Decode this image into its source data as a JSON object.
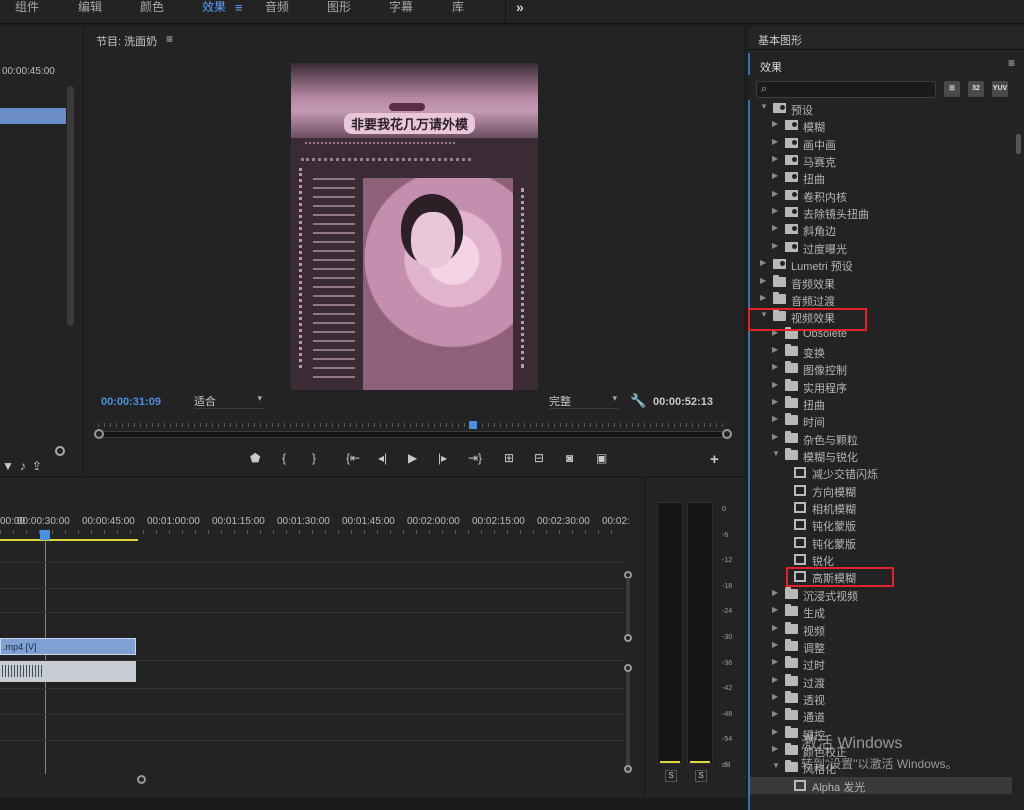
{
  "workspaces": [
    "组件",
    "编辑",
    "颜色",
    "效果",
    "音频",
    "图形",
    "字幕",
    "库"
  ],
  "active_workspace": "效果",
  "source_panel": {
    "timecode": "00:00:45:00"
  },
  "program": {
    "title": "节目: 洗面奶",
    "caption": "非要我花几万请外模",
    "current_time": "00:00:31:09",
    "fit": "适合",
    "quality": "完整",
    "duration": "00:00:52:13"
  },
  "right_panel": {
    "essential_graphics_title": "基本图形",
    "effects_title": "效果",
    "buttons": [
      "32",
      "YUV"
    ],
    "tree": [
      {
        "label": "预设",
        "level": 0,
        "icon": "preset",
        "expanded": true
      },
      {
        "label": "模糊",
        "level": 1,
        "icon": "preset"
      },
      {
        "label": "画中画",
        "level": 1,
        "icon": "preset"
      },
      {
        "label": "马赛克",
        "level": 1,
        "icon": "preset"
      },
      {
        "label": "扭曲",
        "level": 1,
        "icon": "preset"
      },
      {
        "label": "卷积内核",
        "level": 1,
        "icon": "preset"
      },
      {
        "label": "去除镜头扭曲",
        "level": 1,
        "icon": "preset"
      },
      {
        "label": "斜角边",
        "level": 1,
        "icon": "preset"
      },
      {
        "label": "过度曝光",
        "level": 1,
        "icon": "preset"
      },
      {
        "label": "Lumetri 预设",
        "level": 0,
        "icon": "preset"
      },
      {
        "label": "音频效果",
        "level": 0,
        "icon": "folder"
      },
      {
        "label": "音频过渡",
        "level": 0,
        "icon": "folder"
      },
      {
        "label": "视频效果",
        "level": 0,
        "icon": "folder",
        "expanded": true
      },
      {
        "label": "Obsolete",
        "level": 1,
        "icon": "folder"
      },
      {
        "label": "变换",
        "level": 1,
        "icon": "folder"
      },
      {
        "label": "图像控制",
        "level": 1,
        "icon": "folder"
      },
      {
        "label": "实用程序",
        "level": 1,
        "icon": "folder"
      },
      {
        "label": "扭曲",
        "level": 1,
        "icon": "folder"
      },
      {
        "label": "时间",
        "level": 1,
        "icon": "folder"
      },
      {
        "label": "杂色与颗粒",
        "level": 1,
        "icon": "folder"
      },
      {
        "label": "模糊与锐化",
        "level": 1,
        "icon": "folder",
        "expanded": true
      },
      {
        "label": "减少交错闪烁",
        "level": 2,
        "icon": "effect"
      },
      {
        "label": "方向模糊",
        "level": 2,
        "icon": "effect"
      },
      {
        "label": "相机模糊",
        "level": 2,
        "icon": "effect"
      },
      {
        "label": "钝化蒙版",
        "level": 2,
        "icon": "effect"
      },
      {
        "label": "钝化蒙版",
        "level": 2,
        "icon": "effect"
      },
      {
        "label": "锐化",
        "level": 2,
        "icon": "effect"
      },
      {
        "label": "高斯模糊",
        "level": 2,
        "icon": "effect"
      },
      {
        "label": "沉浸式视频",
        "level": 1,
        "icon": "folder"
      },
      {
        "label": "生成",
        "level": 1,
        "icon": "folder"
      },
      {
        "label": "视频",
        "level": 1,
        "icon": "folder"
      },
      {
        "label": "调整",
        "level": 1,
        "icon": "folder"
      },
      {
        "label": "过时",
        "level": 1,
        "icon": "folder"
      },
      {
        "label": "过渡",
        "level": 1,
        "icon": "folder"
      },
      {
        "label": "透视",
        "level": 1,
        "icon": "folder"
      },
      {
        "label": "通道",
        "level": 1,
        "icon": "folder"
      },
      {
        "label": "键控",
        "level": 1,
        "icon": "folder"
      },
      {
        "label": "颜色校正",
        "level": 1,
        "icon": "folder"
      },
      {
        "label": "风格化",
        "level": 1,
        "icon": "folder",
        "expanded": true
      },
      {
        "label": "Alpha 发光",
        "level": 2,
        "icon": "effect",
        "selected": true
      }
    ]
  },
  "timeline": {
    "ruler": [
      "00:00",
      "00:00:30:00",
      "00:00:45:00",
      "00:01:00:00",
      "00:01:15:00",
      "00:01:30:00",
      "00:01:45:00",
      "00:02:00:00",
      "00:02:15:00",
      "00:02:30:00",
      "00:02:"
    ],
    "video_clip": ".mp4 [V]"
  },
  "meters": {
    "scale": [
      "0",
      "-6",
      "-12",
      "-18",
      "-24",
      "-30",
      "-36",
      "-42",
      "-48",
      "-54",
      "dB"
    ],
    "solo": [
      "S",
      "S"
    ]
  },
  "watermark": {
    "line1": "激活 Windows",
    "line2": "转到\"设置\"以激活 Windows。"
  }
}
